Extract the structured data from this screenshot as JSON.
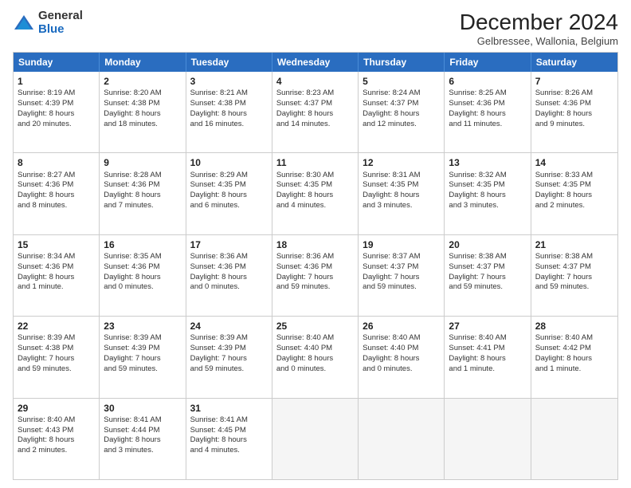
{
  "logo": {
    "general": "General",
    "blue": "Blue"
  },
  "title": "December 2024",
  "subtitle": "Gelbressee, Wallonia, Belgium",
  "header_days": [
    "Sunday",
    "Monday",
    "Tuesday",
    "Wednesday",
    "Thursday",
    "Friday",
    "Saturday"
  ],
  "weeks": [
    [
      {
        "day": "1",
        "lines": [
          "Sunrise: 8:19 AM",
          "Sunset: 4:39 PM",
          "Daylight: 8 hours",
          "and 20 minutes."
        ]
      },
      {
        "day": "2",
        "lines": [
          "Sunrise: 8:20 AM",
          "Sunset: 4:38 PM",
          "Daylight: 8 hours",
          "and 18 minutes."
        ]
      },
      {
        "day": "3",
        "lines": [
          "Sunrise: 8:21 AM",
          "Sunset: 4:38 PM",
          "Daylight: 8 hours",
          "and 16 minutes."
        ]
      },
      {
        "day": "4",
        "lines": [
          "Sunrise: 8:23 AM",
          "Sunset: 4:37 PM",
          "Daylight: 8 hours",
          "and 14 minutes."
        ]
      },
      {
        "day": "5",
        "lines": [
          "Sunrise: 8:24 AM",
          "Sunset: 4:37 PM",
          "Daylight: 8 hours",
          "and 12 minutes."
        ]
      },
      {
        "day": "6",
        "lines": [
          "Sunrise: 8:25 AM",
          "Sunset: 4:36 PM",
          "Daylight: 8 hours",
          "and 11 minutes."
        ]
      },
      {
        "day": "7",
        "lines": [
          "Sunrise: 8:26 AM",
          "Sunset: 4:36 PM",
          "Daylight: 8 hours",
          "and 9 minutes."
        ]
      }
    ],
    [
      {
        "day": "8",
        "lines": [
          "Sunrise: 8:27 AM",
          "Sunset: 4:36 PM",
          "Daylight: 8 hours",
          "and 8 minutes."
        ]
      },
      {
        "day": "9",
        "lines": [
          "Sunrise: 8:28 AM",
          "Sunset: 4:36 PM",
          "Daylight: 8 hours",
          "and 7 minutes."
        ]
      },
      {
        "day": "10",
        "lines": [
          "Sunrise: 8:29 AM",
          "Sunset: 4:35 PM",
          "Daylight: 8 hours",
          "and 6 minutes."
        ]
      },
      {
        "day": "11",
        "lines": [
          "Sunrise: 8:30 AM",
          "Sunset: 4:35 PM",
          "Daylight: 8 hours",
          "and 4 minutes."
        ]
      },
      {
        "day": "12",
        "lines": [
          "Sunrise: 8:31 AM",
          "Sunset: 4:35 PM",
          "Daylight: 8 hours",
          "and 3 minutes."
        ]
      },
      {
        "day": "13",
        "lines": [
          "Sunrise: 8:32 AM",
          "Sunset: 4:35 PM",
          "Daylight: 8 hours",
          "and 3 minutes."
        ]
      },
      {
        "day": "14",
        "lines": [
          "Sunrise: 8:33 AM",
          "Sunset: 4:35 PM",
          "Daylight: 8 hours",
          "and 2 minutes."
        ]
      }
    ],
    [
      {
        "day": "15",
        "lines": [
          "Sunrise: 8:34 AM",
          "Sunset: 4:36 PM",
          "Daylight: 8 hours",
          "and 1 minute."
        ]
      },
      {
        "day": "16",
        "lines": [
          "Sunrise: 8:35 AM",
          "Sunset: 4:36 PM",
          "Daylight: 8 hours",
          "and 0 minutes."
        ]
      },
      {
        "day": "17",
        "lines": [
          "Sunrise: 8:36 AM",
          "Sunset: 4:36 PM",
          "Daylight: 8 hours",
          "and 0 minutes."
        ]
      },
      {
        "day": "18",
        "lines": [
          "Sunrise: 8:36 AM",
          "Sunset: 4:36 PM",
          "Daylight: 7 hours",
          "and 59 minutes."
        ]
      },
      {
        "day": "19",
        "lines": [
          "Sunrise: 8:37 AM",
          "Sunset: 4:37 PM",
          "Daylight: 7 hours",
          "and 59 minutes."
        ]
      },
      {
        "day": "20",
        "lines": [
          "Sunrise: 8:38 AM",
          "Sunset: 4:37 PM",
          "Daylight: 7 hours",
          "and 59 minutes."
        ]
      },
      {
        "day": "21",
        "lines": [
          "Sunrise: 8:38 AM",
          "Sunset: 4:37 PM",
          "Daylight: 7 hours",
          "and 59 minutes."
        ]
      }
    ],
    [
      {
        "day": "22",
        "lines": [
          "Sunrise: 8:39 AM",
          "Sunset: 4:38 PM",
          "Daylight: 7 hours",
          "and 59 minutes."
        ]
      },
      {
        "day": "23",
        "lines": [
          "Sunrise: 8:39 AM",
          "Sunset: 4:39 PM",
          "Daylight: 7 hours",
          "and 59 minutes."
        ]
      },
      {
        "day": "24",
        "lines": [
          "Sunrise: 8:39 AM",
          "Sunset: 4:39 PM",
          "Daylight: 7 hours",
          "and 59 minutes."
        ]
      },
      {
        "day": "25",
        "lines": [
          "Sunrise: 8:40 AM",
          "Sunset: 4:40 PM",
          "Daylight: 8 hours",
          "and 0 minutes."
        ]
      },
      {
        "day": "26",
        "lines": [
          "Sunrise: 8:40 AM",
          "Sunset: 4:40 PM",
          "Daylight: 8 hours",
          "and 0 minutes."
        ]
      },
      {
        "day": "27",
        "lines": [
          "Sunrise: 8:40 AM",
          "Sunset: 4:41 PM",
          "Daylight: 8 hours",
          "and 1 minute."
        ]
      },
      {
        "day": "28",
        "lines": [
          "Sunrise: 8:40 AM",
          "Sunset: 4:42 PM",
          "Daylight: 8 hours",
          "and 1 minute."
        ]
      }
    ],
    [
      {
        "day": "29",
        "lines": [
          "Sunrise: 8:40 AM",
          "Sunset: 4:43 PM",
          "Daylight: 8 hours",
          "and 2 minutes."
        ]
      },
      {
        "day": "30",
        "lines": [
          "Sunrise: 8:41 AM",
          "Sunset: 4:44 PM",
          "Daylight: 8 hours",
          "and 3 minutes."
        ]
      },
      {
        "day": "31",
        "lines": [
          "Sunrise: 8:41 AM",
          "Sunset: 4:45 PM",
          "Daylight: 8 hours",
          "and 4 minutes."
        ]
      },
      {
        "day": "",
        "lines": []
      },
      {
        "day": "",
        "lines": []
      },
      {
        "day": "",
        "lines": []
      },
      {
        "day": "",
        "lines": []
      }
    ]
  ]
}
